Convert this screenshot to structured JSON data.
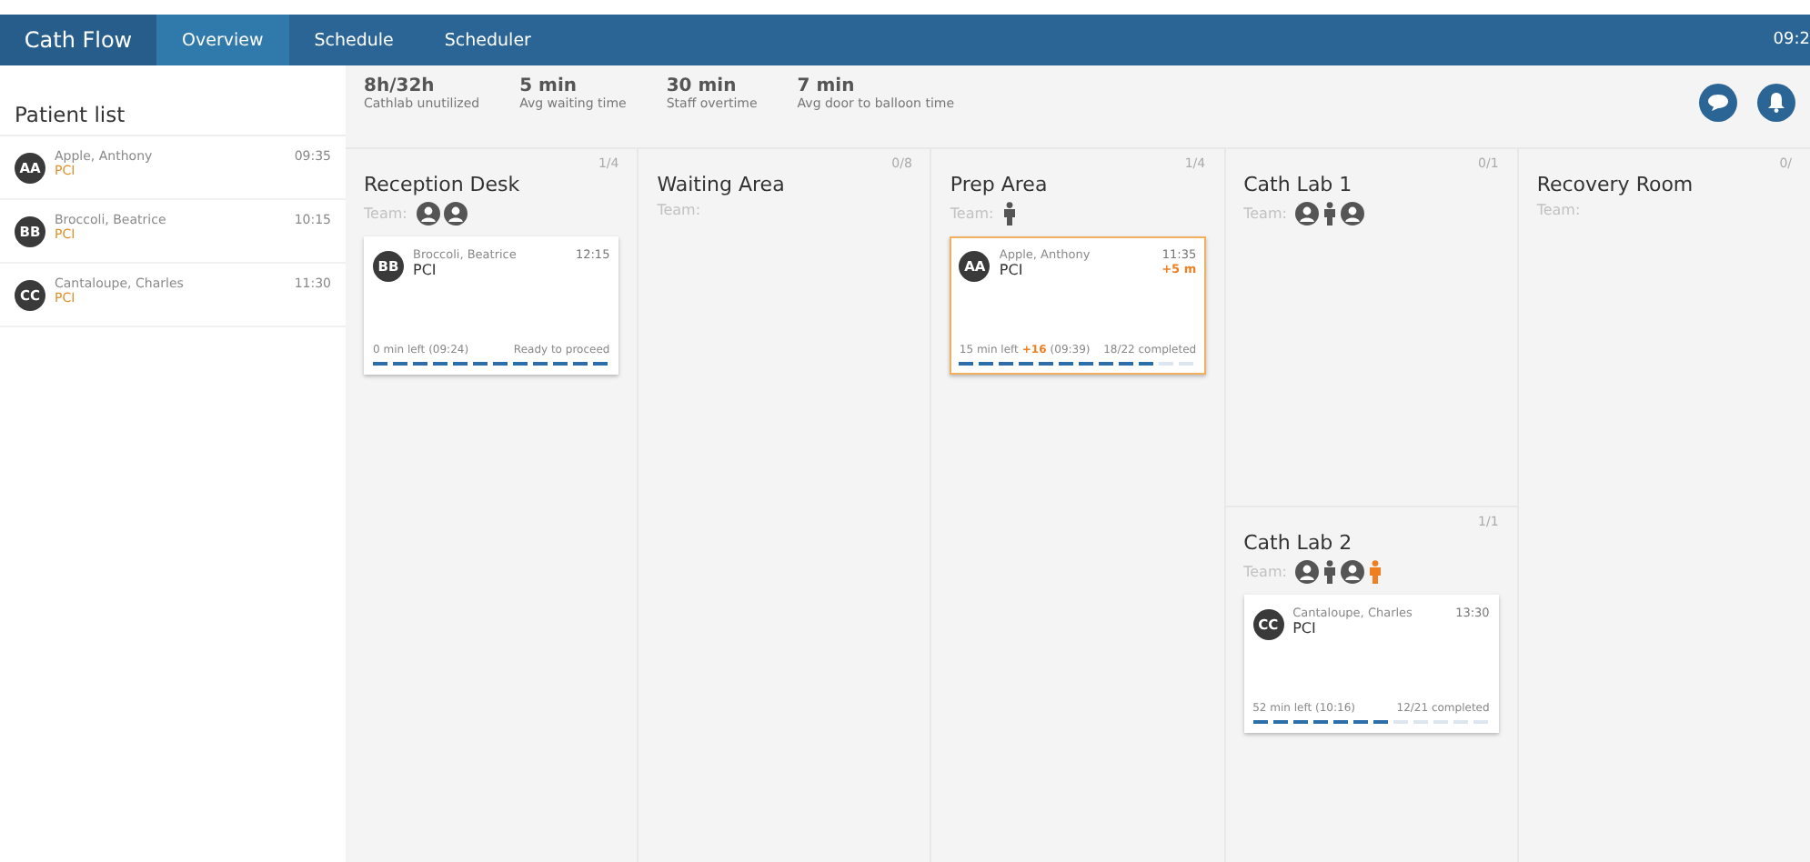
{
  "app": {
    "title": "Cath Flow",
    "clock": "09:2"
  },
  "nav_tabs": [
    {
      "label": "Overview",
      "selected": true
    },
    {
      "label": "Schedule",
      "selected": false
    },
    {
      "label": "Scheduler",
      "selected": false
    }
  ],
  "patient_list": {
    "title": "Patient list",
    "items": [
      {
        "initials": "AA",
        "name": "Apple, Anthony",
        "procedure": "PCI",
        "time": "09:35"
      },
      {
        "initials": "BB",
        "name": "Broccoli, Beatrice",
        "procedure": "PCI",
        "time": "10:15"
      },
      {
        "initials": "CC",
        "name": "Cantaloupe, Charles",
        "procedure": "PCI",
        "time": "11:30"
      }
    ]
  },
  "stats": [
    {
      "value": "8h/32h",
      "label": "Cathlab unutilized"
    },
    {
      "value": "5 min",
      "label": "Avg waiting time"
    },
    {
      "value": "30 min",
      "label": "Staff overtime"
    },
    {
      "value": "7 min",
      "label": "Avg door to balloon time"
    }
  ],
  "columns": [
    {
      "rooms": [
        {
          "name": "Reception Desk",
          "count": "1/4",
          "team_label": "Team:",
          "team": [
            {
              "kind": "staff"
            },
            {
              "kind": "staff"
            }
          ],
          "cards": [
            {
              "initials": "BB",
              "name": "Broccoli, Beatrice",
              "procedure": "PCI",
              "time": "12:15",
              "delayed": false,
              "time_left": "0 min left (09:24)",
              "status": "Ready to proceed",
              "level": 1
            }
          ]
        }
      ]
    },
    {
      "rooms": [
        {
          "name": "Waiting Area",
          "count": "0/8",
          "team_label": "Team:"
        }
      ]
    },
    {
      "rooms": [
        {
          "name": "Prep Area",
          "count": "1/4",
          "team_label": "Team:",
          "team": [
            {
              "kind": "person",
              "color": "#555555"
            }
          ],
          "cards": [
            {
              "initials": "AA",
              "name": "Apple, Anthony",
              "procedure": "PCI",
              "time": "11:35",
              "delay": "+5 m",
              "delayed": true,
              "time_left": "15 min left",
              "time_delay": "+16",
              "time_end": "(09:39)",
              "status": "18/22 completed",
              "level": 0.818
            }
          ]
        }
      ]
    },
    {
      "rooms": [
        {
          "name": "Cath Lab 1",
          "count": "0/1",
          "team_label": "Team:",
          "team": [
            {
              "kind": "staff"
            },
            {
              "kind": "person",
              "color": "#555555"
            },
            {
              "kind": "staff"
            }
          ]
        },
        {
          "name": "Cath Lab 2",
          "count": "1/1",
          "team_label": "Team:",
          "team": [
            {
              "kind": "staff"
            },
            {
              "kind": "person",
              "color": "#555555"
            },
            {
              "kind": "staff"
            },
            {
              "kind": "person",
              "color": "#f07f22"
            }
          ],
          "cards": [
            {
              "initials": "CC",
              "name": "Cantaloupe, Charles",
              "procedure": "PCI",
              "time": "13:30",
              "delayed": false,
              "time_left": "52 min left (10:16)",
              "status": "12/21 completed",
              "level": 0.571
            }
          ]
        }
      ]
    },
    {
      "rooms": [
        {
          "name": "Recovery Room",
          "count": "0/",
          "team_label": "Team:"
        }
      ]
    }
  ]
}
